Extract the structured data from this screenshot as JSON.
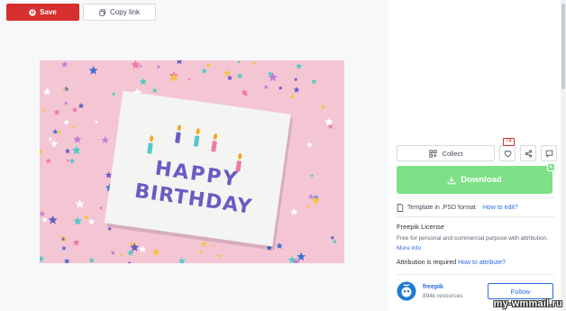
{
  "toolbar": {
    "save_label": "Save",
    "copy_label": "Copy link"
  },
  "preview": {
    "card_lines": [
      "HAPPY",
      "BIRTHDAY"
    ],
    "background_color": "#f4c6d4",
    "card_color": "#f4f4f2",
    "text_color": "#6a5cc2"
  },
  "actions": {
    "collect_label": "Collect",
    "likes_count": "74",
    "download_label": "Download"
  },
  "template": {
    "format_text": "Template in .PSD format",
    "help_link": "How to edit?"
  },
  "license": {
    "title": "Freepik License",
    "description": "Free for personal and commercial purpose with attribution.",
    "more_link": "More info"
  },
  "attribution": {
    "text": "Attribution is required",
    "link": "How to attribute?"
  },
  "author": {
    "name": "freepik",
    "resources": "894k resources",
    "follow_label": "Follow"
  },
  "watermark": "my-wmmail.ru",
  "colors": {
    "save": "#d52f2f",
    "download": "#7ee087",
    "link": "#2b6ae6"
  }
}
